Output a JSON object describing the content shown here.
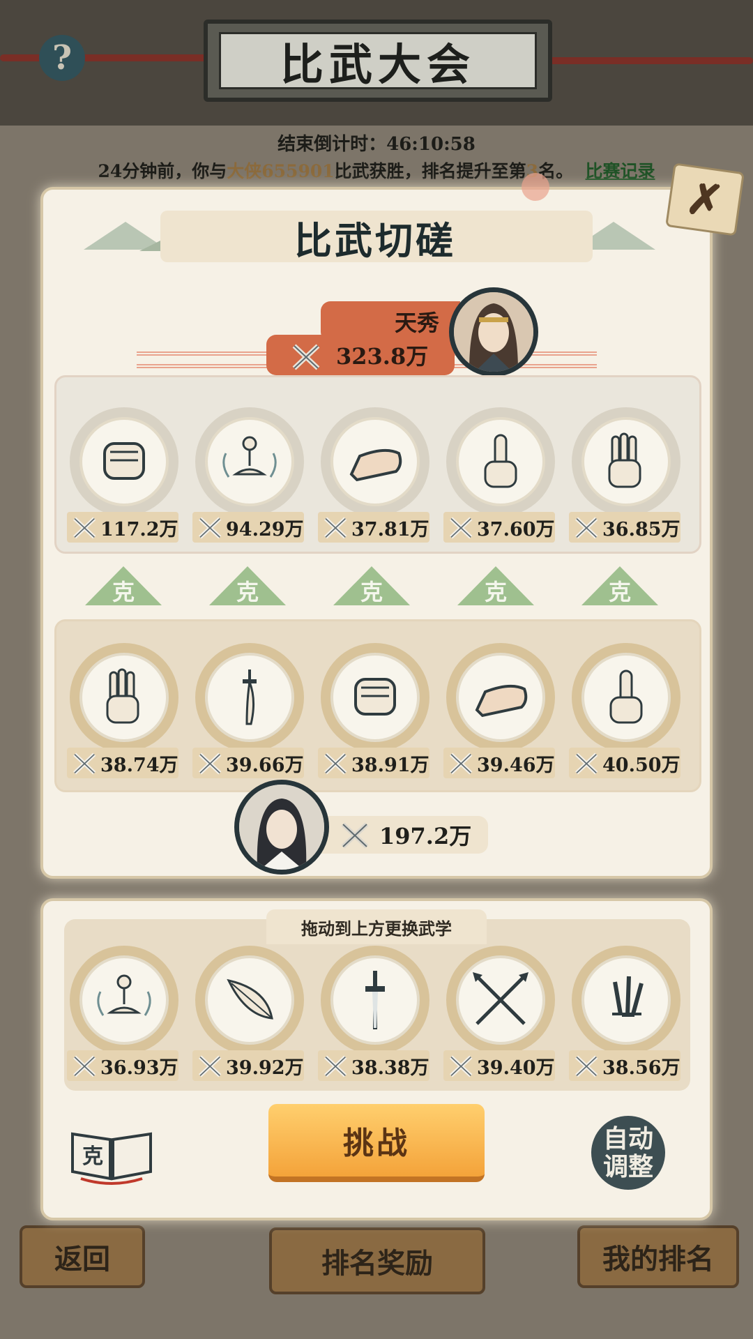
{
  "header": {
    "title": "比武大会",
    "help_icon": "?"
  },
  "hud": {
    "countdown_label": "结束倒计时：",
    "countdown_value": "46:10:58",
    "news_prefix": "24分钟前，你与",
    "news_opponent": "大侠655901",
    "news_mid": "比武获胜，排名提升至第",
    "news_rank": "3",
    "news_suffix": "名。",
    "record_link": "比赛记录"
  },
  "dialog": {
    "title": "比武切磋",
    "close_icon": "x-mark-icon",
    "opponent": {
      "name": "天秀",
      "power": "323.8万"
    },
    "opponent_skills": [
      {
        "icon": "fist-icon",
        "power": "117.2万"
      },
      {
        "icon": "meditation-icon",
        "power": "94.29万"
      },
      {
        "icon": "shoe-icon",
        "power": "37.81万"
      },
      {
        "icon": "finger-icon",
        "power": "37.60万"
      },
      {
        "icon": "palm-icon",
        "power": "36.85万"
      }
    ],
    "counter_label": "克",
    "player_skills": [
      {
        "icon": "palm-icon",
        "power": "38.74万"
      },
      {
        "icon": "saber-icon",
        "power": "39.66万"
      },
      {
        "icon": "fist-icon",
        "power": "38.91万"
      },
      {
        "icon": "shoe-icon",
        "power": "39.46万"
      },
      {
        "icon": "finger-icon",
        "power": "40.50万"
      }
    ],
    "player": {
      "power": "197.2万"
    }
  },
  "inventory": {
    "hint": "拖动到上方更换武学",
    "skills": [
      {
        "icon": "meditation-icon",
        "power": "36.93万"
      },
      {
        "icon": "feather-icon",
        "power": "39.92万"
      },
      {
        "icon": "sword-icon",
        "power": "38.38万"
      },
      {
        "icon": "crossed-spears-icon",
        "power": "39.40万"
      },
      {
        "icon": "daggers-icon",
        "power": "38.56万"
      }
    ],
    "book_label": "克",
    "challenge_label": "挑战",
    "auto_adjust_label": "自动调整"
  },
  "bottom_nav": {
    "back": "返回",
    "rank_rewards": "排名奖励",
    "my_rank": "我的排名"
  },
  "colors": {
    "accent_orange": "#d36b47",
    "button_gold": "#f4a33a",
    "counter_green": "#9fc08f",
    "panel_cream": "#f6f1e6"
  }
}
